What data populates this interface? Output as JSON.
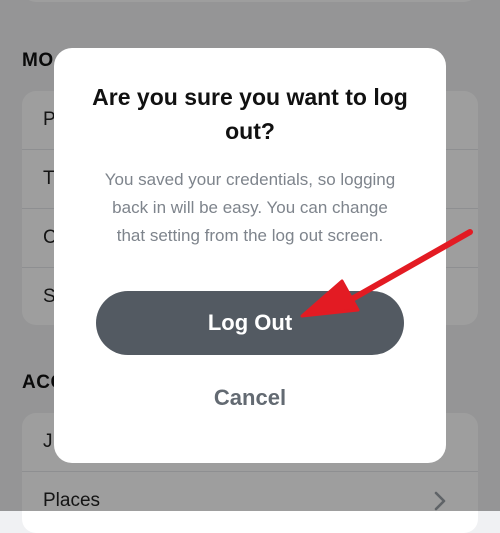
{
  "background": {
    "section_more_label": "MO",
    "more_rows": [
      {
        "label": "P"
      },
      {
        "label": "T"
      },
      {
        "label": "C"
      },
      {
        "label": "S"
      }
    ],
    "section_account_label": "ACC",
    "account_rows": [
      {
        "label": "J"
      },
      {
        "label": "Places"
      }
    ]
  },
  "dialog": {
    "title": "Are you sure you want to log out?",
    "body": "You saved your credentials, so logging back in will be easy. You can change that setting from the log out screen.",
    "primary_label": "Log Out",
    "cancel_label": "Cancel"
  },
  "colors": {
    "primary_button": "#535a62",
    "annotation_arrow": "#e31b23",
    "body_text": "#7e848c"
  },
  "icons": {
    "row_chevron": "chevron-right-icon",
    "annotation": "red-arrow-annotation"
  }
}
